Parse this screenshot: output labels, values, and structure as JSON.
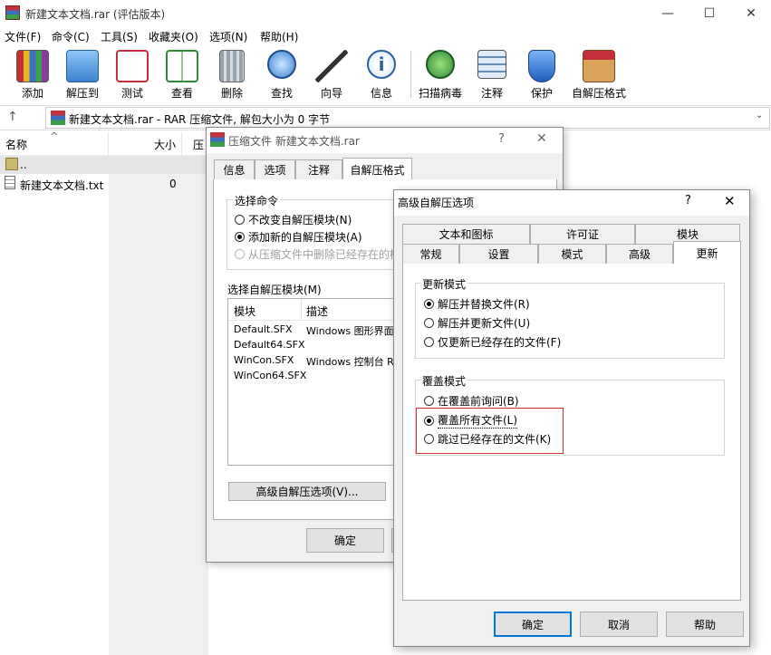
{
  "app": {
    "title": "新建文本文档.rar (评估版本)",
    "minimize": "—",
    "maximize": "☐",
    "close": "✕"
  },
  "menu": [
    "文件(F)",
    "命令(C)",
    "工具(S)",
    "收藏夹(O)",
    "选项(N)",
    "帮助(H)"
  ],
  "toolbar": [
    {
      "label": "添加",
      "icon": "add-archive-icon"
    },
    {
      "label": "解压到",
      "icon": "extract-to-icon"
    },
    {
      "label": "测试",
      "icon": "test-icon"
    },
    {
      "label": "查看",
      "icon": "view-icon"
    },
    {
      "label": "删除",
      "icon": "delete-icon"
    },
    {
      "label": "查找",
      "icon": "find-icon"
    },
    {
      "label": "向导",
      "icon": "wizard-icon"
    },
    {
      "label": "信息",
      "icon": "info-icon"
    },
    {
      "label": "扫描病毒",
      "icon": "virus-scan-icon"
    },
    {
      "label": "注释",
      "icon": "comment-icon"
    },
    {
      "label": "保护",
      "icon": "protect-icon"
    },
    {
      "label": "自解压格式",
      "icon": "sfx-icon"
    }
  ],
  "address": {
    "up": "↑",
    "text": "新建文本文档.rar - RAR 压缩文件, 解包大小为 0 字节",
    "dropdown": "⌄"
  },
  "filelist": {
    "columns": [
      "名称",
      "大小",
      "压"
    ],
    "sort_indicator": "^",
    "rows": [
      {
        "name": "..",
        "size": ""
      },
      {
        "name": "新建文本文档.txt",
        "size": "0"
      }
    ]
  },
  "dialog1": {
    "title": "压缩文件 新建文本文档.rar",
    "help": "?",
    "close": "✕",
    "tabs": [
      "信息",
      "选项",
      "注释",
      "自解压格式"
    ],
    "cmd_group": "选择命令",
    "cmd_options": [
      "不改变自解压模块(N)",
      "添加新的自解压模块(A)",
      "从压缩文件中删除已经存在的模"
    ],
    "module_label": "选择自解压模块(M)",
    "module_headers": [
      "模块",
      "描述"
    ],
    "modules": [
      {
        "name": "Default.SFX",
        "desc": "Windows 图形界面"
      },
      {
        "name": "Default64.SFX",
        "desc": ""
      },
      {
        "name": "WinCon.SFX",
        "desc": "Windows 控制台 RA"
      },
      {
        "name": "WinCon64.SFX",
        "desc": ""
      }
    ],
    "advanced_button": "高级自解压选项(V)...",
    "ok": "确定"
  },
  "dialog2": {
    "title": "高级自解压选项",
    "help": "?",
    "close": "✕",
    "tabs_row1": [
      "文本和图标",
      "许可证",
      "模块"
    ],
    "tabs_row2": [
      "常规",
      "设置",
      "模式",
      "高级",
      "更新"
    ],
    "update_group": "更新模式",
    "update_options": [
      "解压并替换文件(R)",
      "解压并更新文件(U)",
      "仅更新已经存在的文件(F)"
    ],
    "overwrite_group": "覆盖模式",
    "overwrite_options": [
      "在覆盖前询问(B)",
      "覆盖所有文件(L)",
      "跳过已经存在的文件(K)"
    ],
    "ok": "确定",
    "cancel": "取消",
    "help_button": "帮助"
  }
}
